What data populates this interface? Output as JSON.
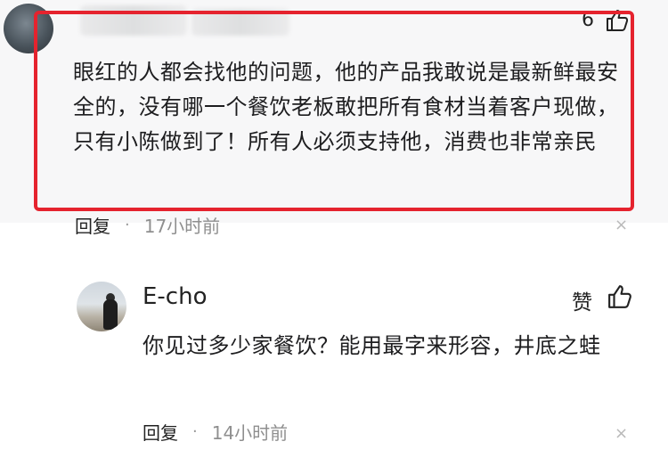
{
  "comment": {
    "like_count": "6",
    "text": "眼红的人都会找他的问题，他的产品我敢说是最新鲜最安全的，没有哪一个餐饮老板敢把所有食材当着客户现做，只有小陈做到了！所有人必须支持他，消费也非常亲民",
    "reply_label": "回复",
    "dot": "·",
    "time": "17小时前",
    "close": "×"
  },
  "reply": {
    "author": "E-cho",
    "like_label": "赞",
    "text": "你见过多少家餐饮？能用最字来形容，井底之蛙",
    "reply_label": "回复",
    "dot": "·",
    "time": "14小时前",
    "close": "×"
  },
  "colors": {
    "highlight_border": "#e5232e",
    "meta_time": "#8f8f8f",
    "background_top": "#f7f7f8"
  },
  "icons": {
    "like": "thumbs-up-icon",
    "close": "close-icon"
  }
}
